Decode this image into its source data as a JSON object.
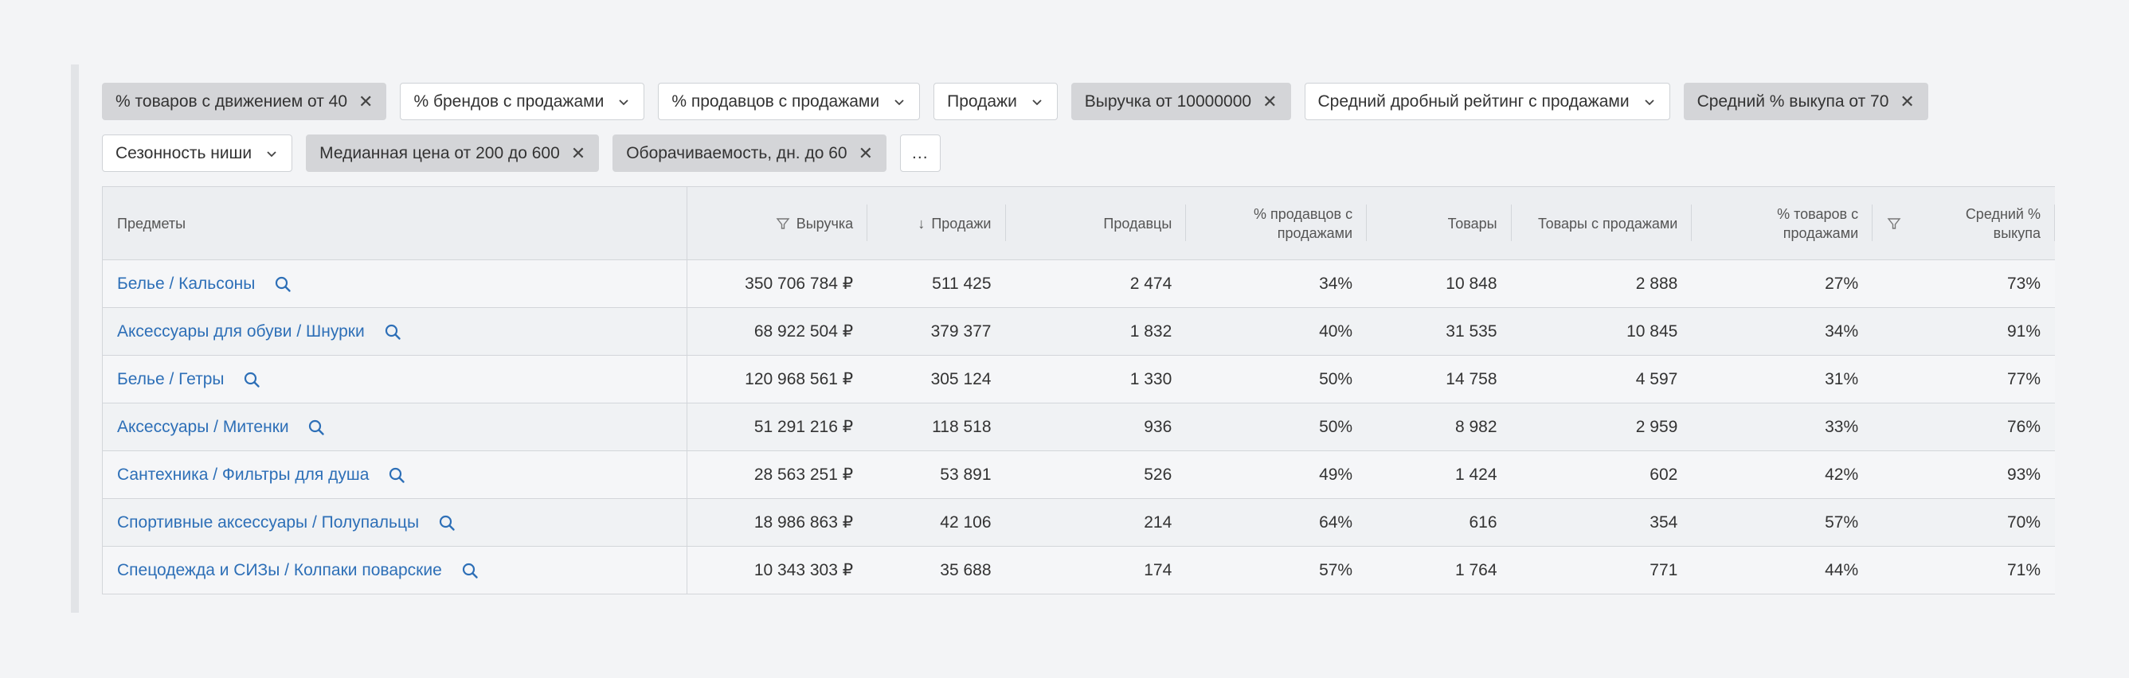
{
  "filters": {
    "row1": [
      {
        "label": "% товаров с движением от 40",
        "active": true
      },
      {
        "label": "% брендов с продажами",
        "active": false
      },
      {
        "label": "% продавцов с продажами",
        "active": false
      },
      {
        "label": "Продажи",
        "active": false
      },
      {
        "label": "Выручка от 10000000",
        "active": true
      },
      {
        "label": "Средний дробный рейтинг с продажами",
        "active": false
      },
      {
        "label": "Средний % выкупа от 70",
        "active": true
      }
    ],
    "row2": [
      {
        "label": "Сезонность ниши",
        "active": false
      },
      {
        "label": "Медианная цена от 200 до 600",
        "active": true
      },
      {
        "label": "Оборачиваемость, дн. до 60",
        "active": true
      }
    ],
    "more_label": "..."
  },
  "table": {
    "headers": {
      "subjects": "Предметы",
      "revenue": "Выручка",
      "sales": "Продажи",
      "sellers": "Продавцы",
      "sellers_with_sales": "% продавцов с продажами",
      "goods": "Товары",
      "goods_with_sales": "Товары с продажами",
      "goods_pct_with_sales": "% товаров с продажами",
      "avg_buyout": "Средний % выкупа"
    },
    "sort_arrow": "↓",
    "rows": [
      {
        "subject": "Белье / Кальсоны",
        "revenue": "350 706 784 ₽",
        "sales": "511 425",
        "sellers": "2 474",
        "sellers_pct": "34%",
        "goods": "10 848",
        "goods_with_sales": "2 888",
        "goods_pct": "27%",
        "buyout": "73%"
      },
      {
        "subject": "Аксессуары для обуви / Шнурки",
        "revenue": "68 922 504 ₽",
        "sales": "379 377",
        "sellers": "1 832",
        "sellers_pct": "40%",
        "goods": "31 535",
        "goods_with_sales": "10 845",
        "goods_pct": "34%",
        "buyout": "91%"
      },
      {
        "subject": "Белье / Гетры",
        "revenue": "120 968 561 ₽",
        "sales": "305 124",
        "sellers": "1 330",
        "sellers_pct": "50%",
        "goods": "14 758",
        "goods_with_sales": "4 597",
        "goods_pct": "31%",
        "buyout": "77%"
      },
      {
        "subject": "Аксессуары / Митенки",
        "revenue": "51 291 216 ₽",
        "sales": "118 518",
        "sellers": "936",
        "sellers_pct": "50%",
        "goods": "8 982",
        "goods_with_sales": "2 959",
        "goods_pct": "33%",
        "buyout": "76%"
      },
      {
        "subject": "Сантехника / Фильтры для душа",
        "revenue": "28 563 251 ₽",
        "sales": "53 891",
        "sellers": "526",
        "sellers_pct": "49%",
        "goods": "1 424",
        "goods_with_sales": "602",
        "goods_pct": "42%",
        "buyout": "93%"
      },
      {
        "subject": "Спортивные аксессуары / Полупальцы",
        "revenue": "18 986 863 ₽",
        "sales": "42 106",
        "sellers": "214",
        "sellers_pct": "64%",
        "goods": "616",
        "goods_with_sales": "354",
        "goods_pct": "57%",
        "buyout": "70%"
      },
      {
        "subject": "Спецодежда и СИЗы / Колпаки поварские",
        "revenue": "10 343 303 ₽",
        "sales": "35 688",
        "sellers": "174",
        "sellers_pct": "57%",
        "goods": "1 764",
        "goods_with_sales": "771",
        "goods_pct": "44%",
        "buyout": "71%"
      }
    ]
  },
  "icons": {
    "chip_close": "close-icon",
    "chip_dropdown": "chevron-down-icon",
    "row_search": "search-icon",
    "header_filter": "filter-icon"
  },
  "colors": {
    "link": "#2d6fb7",
    "active_chip": "#d4d5d8",
    "background": "#f3f4f6"
  }
}
